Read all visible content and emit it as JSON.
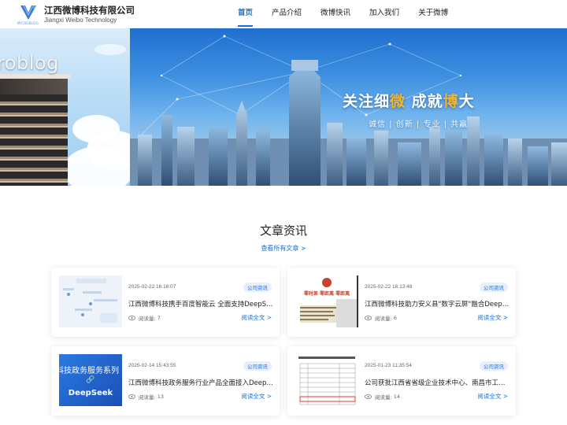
{
  "header": {
    "logo_small": "MICROBLOG",
    "company_name": "江西微博科技有限公司",
    "company_en": "Jiangxi Weibo Technology",
    "nav": [
      {
        "label": "首页",
        "active": true
      },
      {
        "label": "产品介绍",
        "active": false
      },
      {
        "label": "微博快讯",
        "active": false
      },
      {
        "label": "加入我们",
        "active": false
      },
      {
        "label": "关于微博",
        "active": false
      }
    ]
  },
  "banner": {
    "brand_text": "roblog",
    "slogan_parts": [
      "关注细",
      "微",
      " 成就",
      "博",
      "大"
    ],
    "sub_slogan": "诚信 | 创新 | 专业 | 共赢"
  },
  "articles": {
    "title": "文章资讯",
    "view_all": "查看所有文章 >",
    "read_more": "阅读全文 >",
    "views_label": "阅读量:",
    "items": [
      {
        "date": "2025-02-22 16:16:07",
        "tag": "公司资讯",
        "title": "江西微博科技携手百度智能云 全面支持DeepSeek大模型",
        "views": "7"
      },
      {
        "date": "2025-02-22 16:13:48",
        "tag": "公司资讯",
        "title": "江西微博科技助力安义县\"数字云屏\"融合DeepSeek",
        "views": "6"
      },
      {
        "date": "2025-02-14 15:43:55",
        "tag": "公司资讯",
        "title": "江西微博科技政务服务行业产品全面接入DeepSeek大模型",
        "views": "13"
      },
      {
        "date": "2025-01-23 11:35:54",
        "tag": "公司资讯",
        "title": "公司获批江西省省级企业技术中心、南昌市工程技术研究中心",
        "views": "14"
      }
    ],
    "thumb3": {
      "line1": "科技政务服务系列",
      "line2": "DeepSeek"
    },
    "thumb2": {
      "line1": "零时差 零距离 零距离"
    }
  },
  "colors": {
    "accent": "#1f6fd6",
    "highlight": "#f5b52a"
  }
}
